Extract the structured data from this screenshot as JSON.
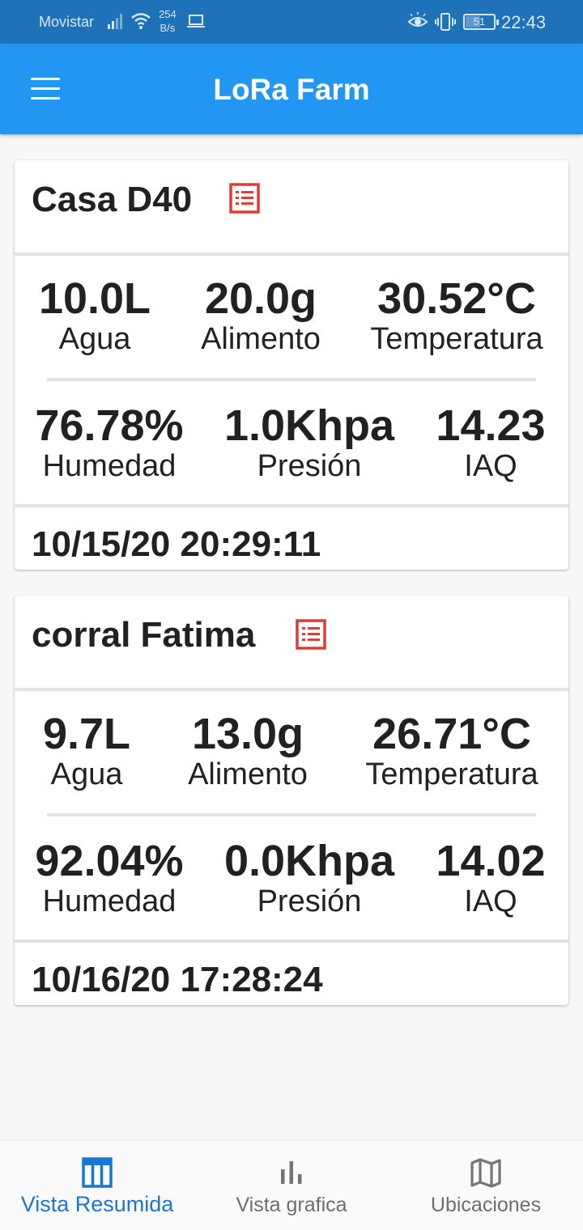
{
  "status_bar": {
    "carrier": "Movistar",
    "net_speed_value": "254",
    "net_speed_unit": "B/s",
    "battery": "51",
    "time": "22:43"
  },
  "app_bar": {
    "title": "LoRa Farm",
    "menu_icon": "hamburger-menu-icon"
  },
  "colors": {
    "app_bar": "#2196f3",
    "status_bar": "#1e72b8",
    "accent_red": "#e53935",
    "nav_active": "#1976d2",
    "nav_inactive": "#757575"
  },
  "devices": [
    {
      "name": "Casa D40",
      "icon": "list-icon",
      "metrics_row1": [
        {
          "value": "10.0L",
          "label": "Agua"
        },
        {
          "value": "20.0g",
          "label": "Alimento"
        },
        {
          "value": "30.52°C",
          "label": "Temperatura"
        }
      ],
      "metrics_row2": [
        {
          "value": "76.78%",
          "label": "Humedad"
        },
        {
          "value": "1.0Khpa",
          "label": "Presión"
        },
        {
          "value": "14.23",
          "label": "IAQ"
        }
      ],
      "timestamp": "10/15/20 20:29:11"
    },
    {
      "name": "corral Fatima",
      "icon": "list-icon",
      "metrics_row1": [
        {
          "value": "9.7L",
          "label": "Agua"
        },
        {
          "value": "13.0g",
          "label": "Alimento"
        },
        {
          "value": "26.71°C",
          "label": "Temperatura"
        }
      ],
      "metrics_row2": [
        {
          "value": "92.04%",
          "label": "Humedad"
        },
        {
          "value": "0.0Khpa",
          "label": "Presión"
        },
        {
          "value": "14.02",
          "label": "IAQ"
        }
      ],
      "timestamp": "10/16/20 17:28:24"
    }
  ],
  "bottom_nav": [
    {
      "label": "Vista Resumida",
      "icon": "table-icon",
      "active": true
    },
    {
      "label": "Vista grafica",
      "icon": "bar-chart-icon",
      "active": false
    },
    {
      "label": "Ubicaciones",
      "icon": "map-icon",
      "active": false
    }
  ]
}
